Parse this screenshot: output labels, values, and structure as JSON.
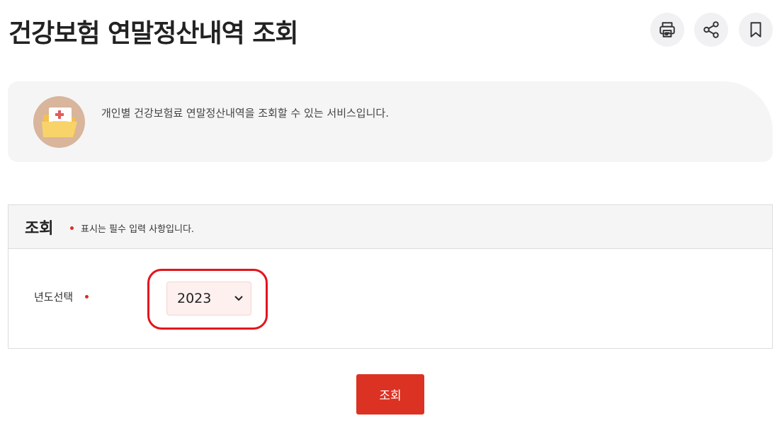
{
  "header": {
    "title": "건강보험 연말정산내역 조회",
    "tools": [
      {
        "name": "print",
        "icon": "printer-icon"
      },
      {
        "name": "share",
        "icon": "share-icon"
      },
      {
        "name": "bookmark",
        "icon": "bookmark-icon"
      }
    ]
  },
  "intro": {
    "icon": "medical-folder-icon",
    "text": "개인별 건강보험료 연말정산내역을 조회할 수 있는 서비스입니다."
  },
  "form": {
    "title": "조회",
    "required_note": "표시는 필수 입력 사항입니다.",
    "year_label": "년도선택",
    "year_value": "2023"
  },
  "submit_label": "조회",
  "colors": {
    "accent": "#dc3223",
    "highlight": "#e3141c",
    "select_bg": "#fdf0ef"
  }
}
